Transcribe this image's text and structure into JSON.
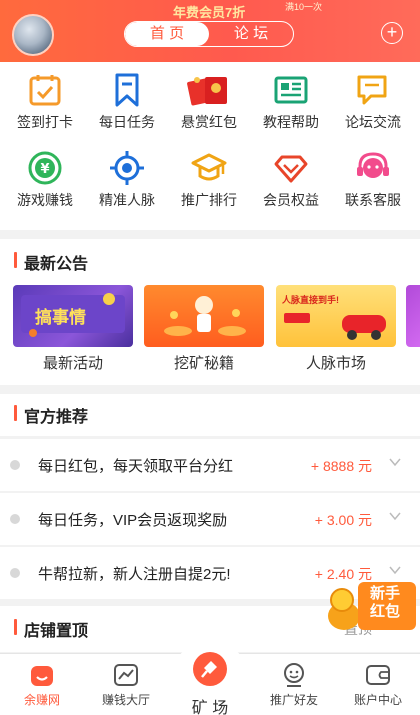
{
  "header": {
    "banner_text": "年费会员7折",
    "banner_side": "满10一次",
    "tabs": [
      {
        "label": "首 页",
        "active": true
      },
      {
        "label": "论 坛",
        "active": false
      }
    ],
    "plus": "+",
    "accent": "#ff5a3c"
  },
  "grid": [
    {
      "label": "签到打卡",
      "icon": "calendar-check-icon"
    },
    {
      "label": "每日任务",
      "icon": "bookmark-icon"
    },
    {
      "label": "悬赏红包",
      "icon": "red-envelope-icon"
    },
    {
      "label": "教程帮助",
      "icon": "newspaper-icon"
    },
    {
      "label": "论坛交流",
      "icon": "chat-bubble-icon"
    },
    {
      "label": "游戏赚钱",
      "icon": "yuan-coin-icon"
    },
    {
      "label": "精准人脉",
      "icon": "crosshair-icon"
    },
    {
      "label": "推广排行",
      "icon": "graduation-cap-icon"
    },
    {
      "label": "会员权益",
      "icon": "diamond-icon"
    },
    {
      "label": "联系客服",
      "icon": "headset-icon"
    }
  ],
  "announcements": {
    "title": "最新公告",
    "cards": [
      {
        "label": "最新活动",
        "image_text": "搞事情"
      },
      {
        "label": "挖矿秘籍",
        "image_text": ""
      },
      {
        "label": "人脉市场",
        "image_text": "人脉直接到手!"
      }
    ]
  },
  "recommend": {
    "title": "官方推荐",
    "rows": [
      {
        "text": "每日红包，每天领取平台分红",
        "amount": "+ 8888 元"
      },
      {
        "text": "每日任务，VIP会员返现奖励",
        "amount": "+ 3.00 元"
      },
      {
        "text": "牛帮拉新，新人注册自提2元!",
        "amount": "+ 2.40 元"
      }
    ]
  },
  "shop": {
    "title": "店铺置顶",
    "right": "置顶"
  },
  "float_badge": {
    "line1": "新手",
    "line2": "红包"
  },
  "tabbar": [
    {
      "label": "余赚网",
      "icon": "home-icon",
      "active": true
    },
    {
      "label": "赚钱大厅",
      "icon": "chart-icon",
      "active": false
    },
    {
      "label": "矿 场",
      "icon": "shovel-icon",
      "active": false
    },
    {
      "label": "推广好友",
      "icon": "face-icon",
      "active": false
    },
    {
      "label": "账户中心",
      "icon": "wallet-icon",
      "active": false
    }
  ]
}
